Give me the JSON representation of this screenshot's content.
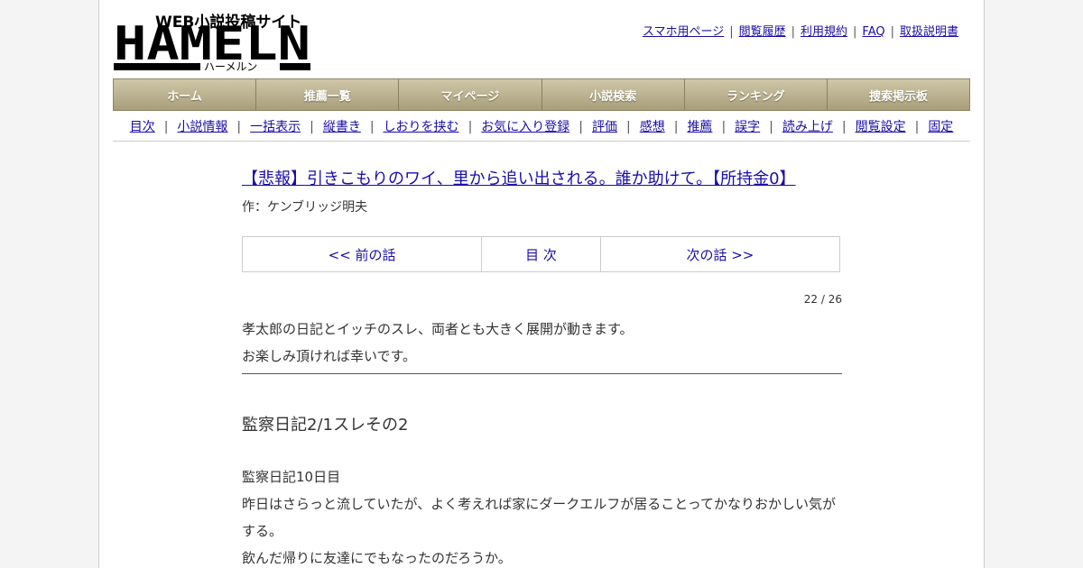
{
  "site": {
    "logo_text": "HAMELN",
    "logo_sub": "WEB小説投稿サイト",
    "logo_kana": "ハーメルン"
  },
  "top_links": [
    "スマホ用ページ",
    "閲覧履歴",
    "利用規約",
    "FAQ",
    "取扱説明書"
  ],
  "main_nav": [
    "ホーム",
    "推薦一覧",
    "マイページ",
    "小説検索",
    "ランキング",
    "捜索掲示板"
  ],
  "sub_nav": [
    "目次",
    "小説情報",
    "一括表示",
    "縦書き",
    "しおりを挟む",
    "お気に入り登録",
    "評価",
    "感想",
    "推薦",
    "誤字",
    "読み上げ",
    "閲覧設定",
    "固定"
  ],
  "novel": {
    "title": "【悲報】引きこもりのワイ、里から追い出される。誰か助けて。【所持金0】",
    "author": "作：ケンブリッジ明夫"
  },
  "chapter_nav": {
    "prev": "<< 前の話",
    "toc": "目 次",
    "next": "次の話 >>"
  },
  "page_count": "22 / 26",
  "preface": [
    "孝太郎の日記とイッチのスレ、両者とも大きく展開が動きます。",
    "お楽しみ頂ければ幸いです。"
  ],
  "chapter_title": "監察日記2/1スレその2",
  "body": [
    "監察日記10日目",
    "昨日はさらっと流していたが、よく考えれば家にダークエルフが居ることってかなりおかしい気が",
    "する。",
    "飲んだ帰りに友達にでもなったのだろうか。"
  ]
}
